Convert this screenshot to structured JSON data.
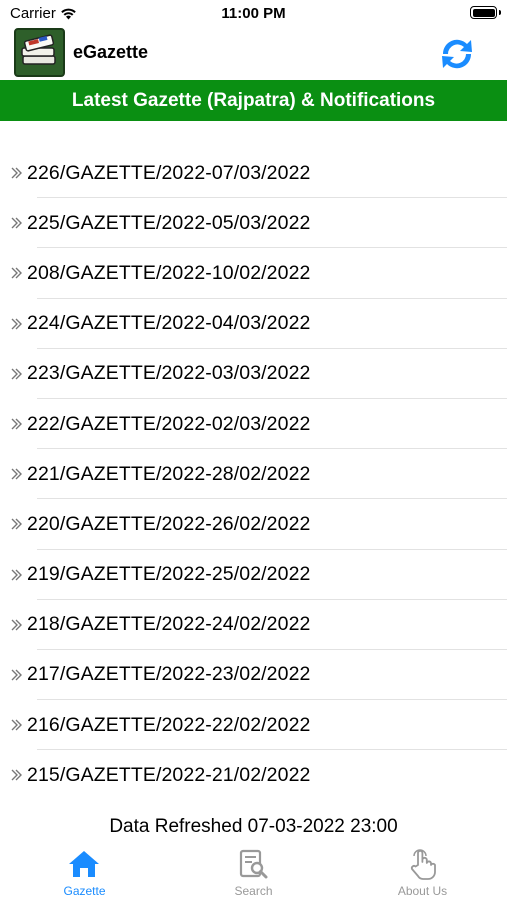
{
  "status_bar": {
    "carrier": "Carrier",
    "time": "11:00 PM"
  },
  "header": {
    "title": "eGazette",
    "logo_icon": "gazette-books-icon",
    "refresh_icon": "refresh-icon"
  },
  "banner": {
    "text": "Latest Gazette (Rajpatra) & Notifications",
    "color": "#0a8f12"
  },
  "gazette_list": [
    "226/GAZETTE/2022-07/03/2022",
    "225/GAZETTE/2022-05/03/2022",
    "208/GAZETTE/2022-10/02/2022",
    "224/GAZETTE/2022-04/03/2022",
    "223/GAZETTE/2022-03/03/2022",
    "222/GAZETTE/2022-02/03/2022",
    "221/GAZETTE/2022-28/02/2022",
    "220/GAZETTE/2022-26/02/2022",
    "219/GAZETTE/2022-25/02/2022",
    "218/GAZETTE/2022-24/02/2022",
    "217/GAZETTE/2022-23/02/2022",
    "216/GAZETTE/2022-22/02/2022",
    "215/GAZETTE/2022-21/02/2022"
  ],
  "footer": {
    "refreshed_text": "Data Refreshed 07-03-2022 23:00"
  },
  "tabs": [
    {
      "label": "Gazette",
      "icon": "home-icon",
      "active": true
    },
    {
      "label": "Search",
      "icon": "search-document-icon",
      "active": false
    },
    {
      "label": "About Us",
      "icon": "hand-pointer-icon",
      "active": false
    }
  ],
  "colors": {
    "accent": "#1a8cff",
    "inactive": "#999999",
    "banner": "#0a8f12"
  }
}
